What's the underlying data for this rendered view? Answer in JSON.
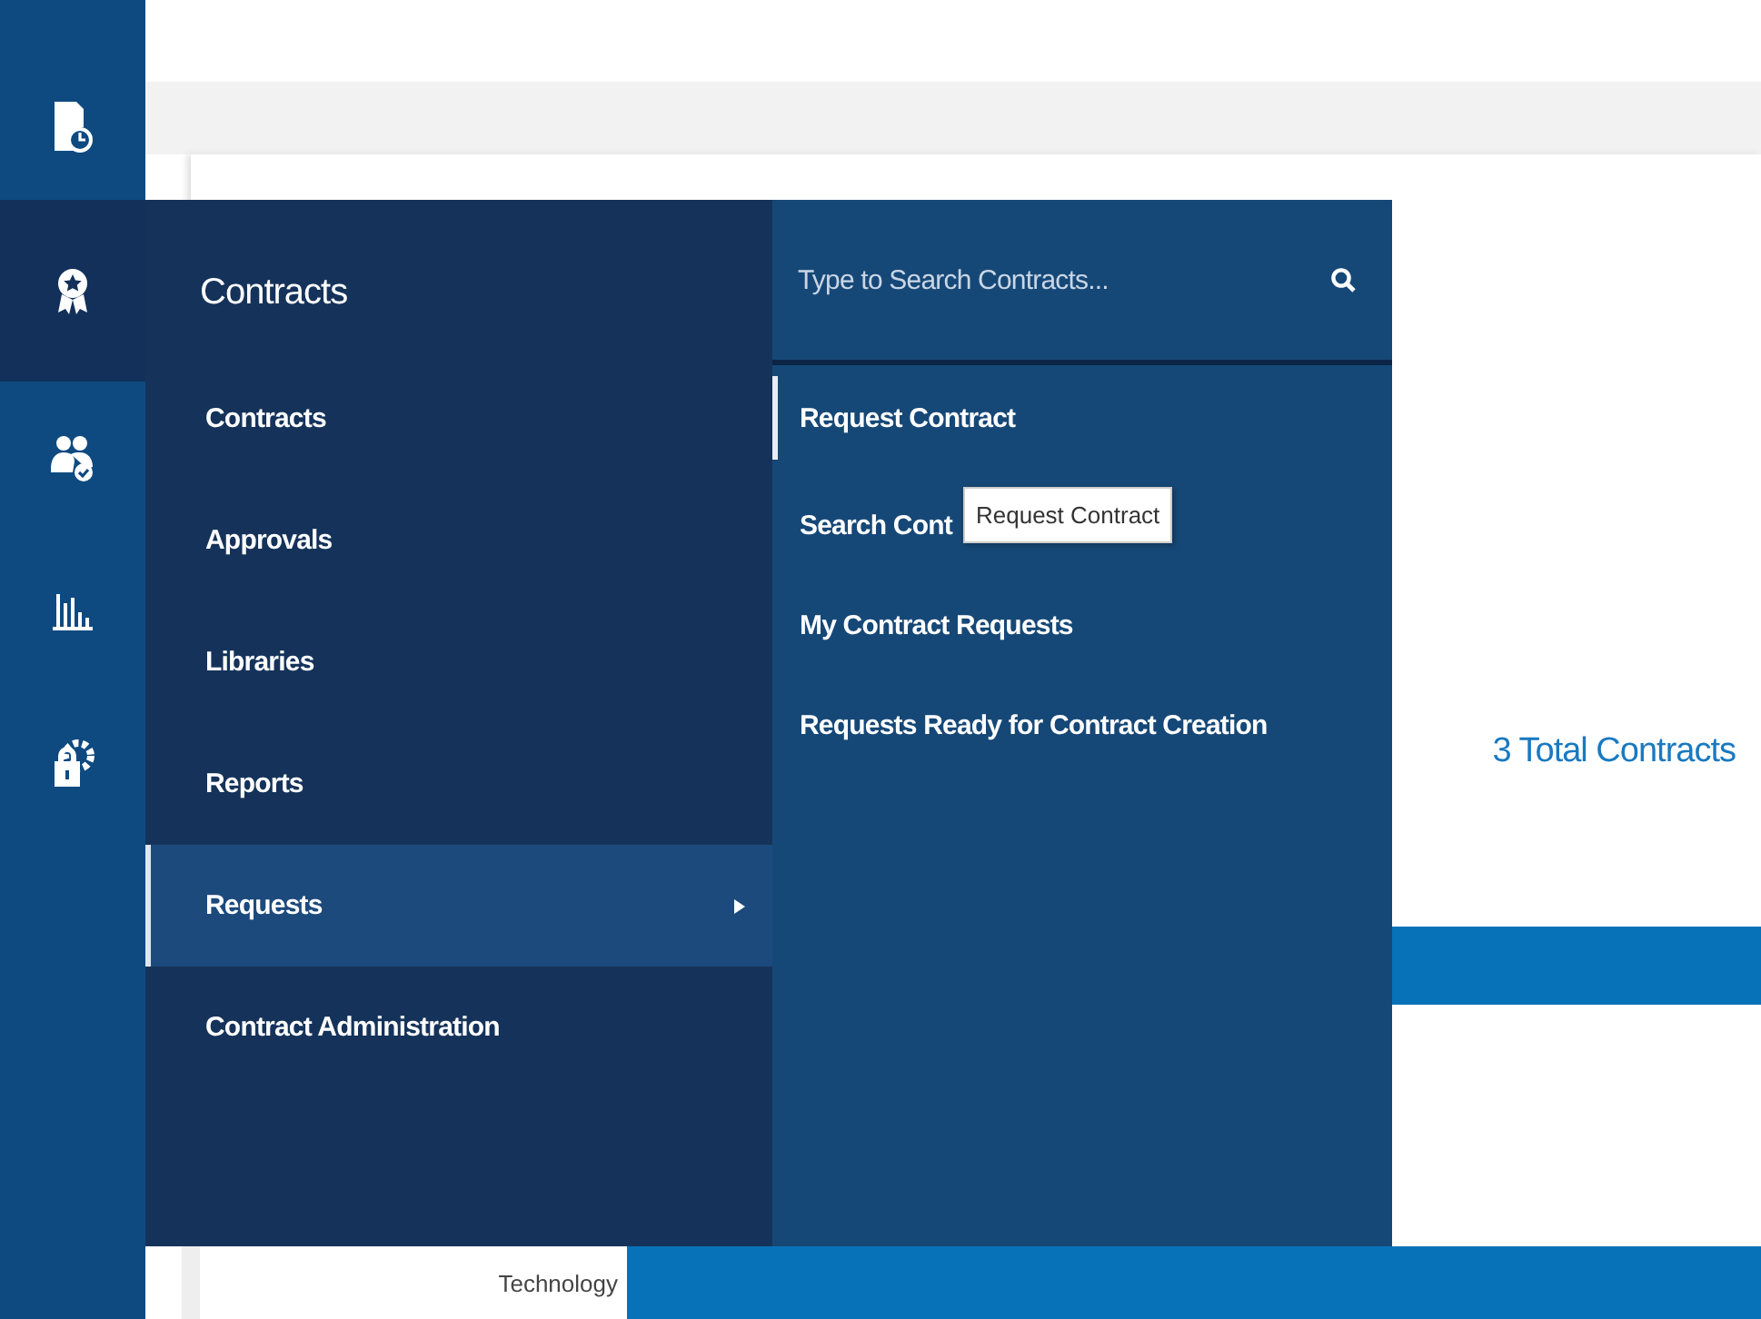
{
  "rail": {
    "items": [
      {
        "kind": "document-clock",
        "selected": false
      },
      {
        "kind": "award",
        "selected": true
      },
      {
        "kind": "people-check",
        "selected": false
      },
      {
        "kind": "bar-chart",
        "selected": false
      },
      {
        "kind": "lock-gear",
        "selected": false
      }
    ]
  },
  "menu": {
    "heading": "Contracts",
    "items": [
      {
        "label": "Contracts",
        "selected": false,
        "has_submenu": false
      },
      {
        "label": "Approvals",
        "selected": false,
        "has_submenu": false
      },
      {
        "label": "Libraries",
        "selected": false,
        "has_submenu": false
      },
      {
        "label": "Reports",
        "selected": false,
        "has_submenu": false
      },
      {
        "label": "Requests",
        "selected": true,
        "has_submenu": true
      },
      {
        "label": "Contract Administration",
        "selected": false,
        "has_submenu": false
      }
    ]
  },
  "submenu": {
    "search": {
      "placeholder": "Type to Search Contracts..."
    },
    "items": [
      {
        "label": "Request Contract",
        "selected": true
      },
      {
        "label": "Search Cont",
        "selected": false
      },
      {
        "label": "My Contract Requests",
        "selected": false
      },
      {
        "label": "Requests Ready for Contract Creation",
        "selected": false
      }
    ],
    "tooltip": "Request Contract"
  },
  "summary": {
    "total": "3 Total Contracts"
  },
  "table": {
    "cell": "Technology"
  }
}
